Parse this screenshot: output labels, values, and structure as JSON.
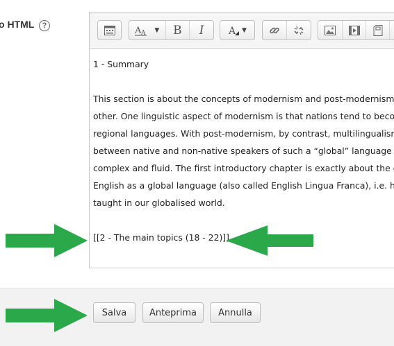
{
  "field": {
    "label": "o HTML",
    "help_icon": "question-circle-icon"
  },
  "toolbar": {
    "groups": [
      [
        "toolbar-toggle-icon"
      ],
      [
        "font-size-icon",
        "bold-icon",
        "italic-icon"
      ],
      [
        "text-color-icon"
      ],
      [
        "link-icon",
        "unlink-icon"
      ],
      [
        "image-icon",
        "video-icon",
        "file-icon"
      ]
    ],
    "bold_label": "B",
    "italic_label": "I"
  },
  "content": {
    "heading": "1 - Summary",
    "paragraph_lines": [
      "This section is about the concepts of modernism and post-modernism,",
      "other. One linguistic aspect of modernism is that nations tend to becom",
      "regional languages. With post-modernism, by contrast, multilingualism",
      "between native and non-native speakers of such a “global” language as",
      "complex and fluid. The first introductory chapter is exactly about  the co",
      "English as a global language (also called English Lingua Franca), i.e. how",
      "taught in our globalised world."
    ],
    "link_text": "[[2 - The main topics (18 - 22)]]"
  },
  "buttons": {
    "save": "Salva",
    "preview": "Anteprima",
    "cancel": "Annulla"
  },
  "colors": {
    "arrow": "#2aa84a"
  }
}
